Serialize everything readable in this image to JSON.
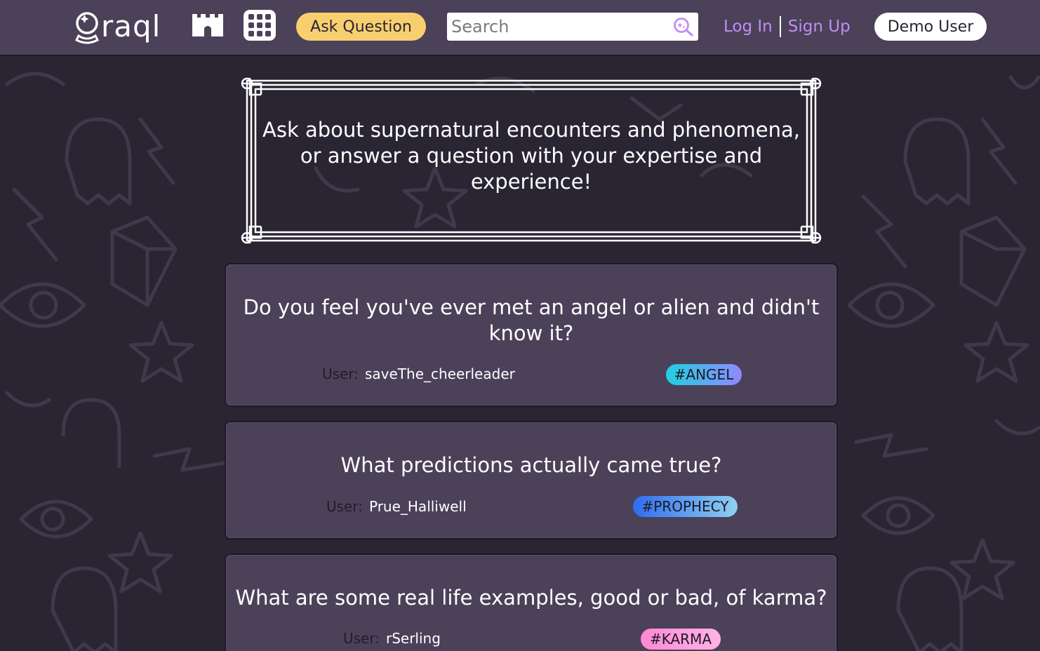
{
  "header": {
    "logo_text": "raql",
    "ask_button_label": "Ask Question",
    "search_placeholder": "Search",
    "login_label": "Log In",
    "signup_label": "Sign Up",
    "user_button_label": "Demo User"
  },
  "banner": {
    "text": "Ask about supernatural encounters and phenomena, or answer a question with your expertise and experience!"
  },
  "questions": [
    {
      "title": "Do you feel you've ever met an angel or alien and didn't know it?",
      "user_label": "User:",
      "user": "saveThe_cheerleader",
      "tag": "#ANGEL",
      "tag_gradient": [
        "#1fd1e0",
        "#8f88ff"
      ]
    },
    {
      "title": "What predictions actually came true?",
      "user_label": "User:",
      "user": "Prue_Halliwell",
      "tag": "#PROPHECY",
      "tag_gradient": [
        "#2f6cf0",
        "#8fd0f0"
      ]
    },
    {
      "title": "What are some real life examples, good or bad, of karma?",
      "user_label": "User:",
      "user": "rSerling",
      "tag": "#KARMA",
      "tag_gradient": [
        "#ff88d6",
        "#ffb3e6"
      ]
    }
  ],
  "colors": {
    "header_bg": "#4b4159",
    "page_bg": "#2a2533",
    "accent_link": "#c28df4",
    "ask_button": "#f7cf6f"
  }
}
